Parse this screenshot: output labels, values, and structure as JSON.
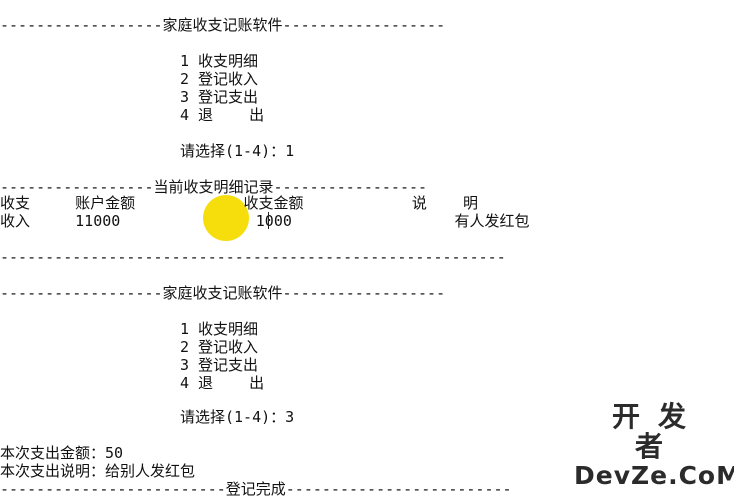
{
  "console": {
    "menu1": {
      "header": "------------------家庭收支记账软件------------------",
      "items": [
        "1 收支明细",
        "2 登记收入",
        "3 登记支出",
        "4 退    出"
      ],
      "prompt": "请选择(1-4)：1"
    },
    "details": {
      "header": "-----------------当前收支明细记录-----------------",
      "columns": "收支     账户金额            收支金额            说    明",
      "row": "收入     11000               1000                  有人发红包",
      "footer": "--------------------------------------------------------"
    },
    "menu2": {
      "header": "------------------家庭收支记账软件------------------",
      "items": [
        "1 收支明细",
        "2 登记收入",
        "3 登记支出",
        "4 退    出"
      ],
      "prompt": "请选择(1-4)：3"
    },
    "expense": {
      "amount": "本次支出金额：50",
      "note": "本次支出说明：给别人发红包",
      "done": "-------------------------登记完成-------------------------"
    }
  },
  "watermark": {
    "top": "开发者",
    "bottom": "DevZe.CoM"
  },
  "colors": {
    "highlight": "#f5dc00",
    "text": "#111111"
  }
}
